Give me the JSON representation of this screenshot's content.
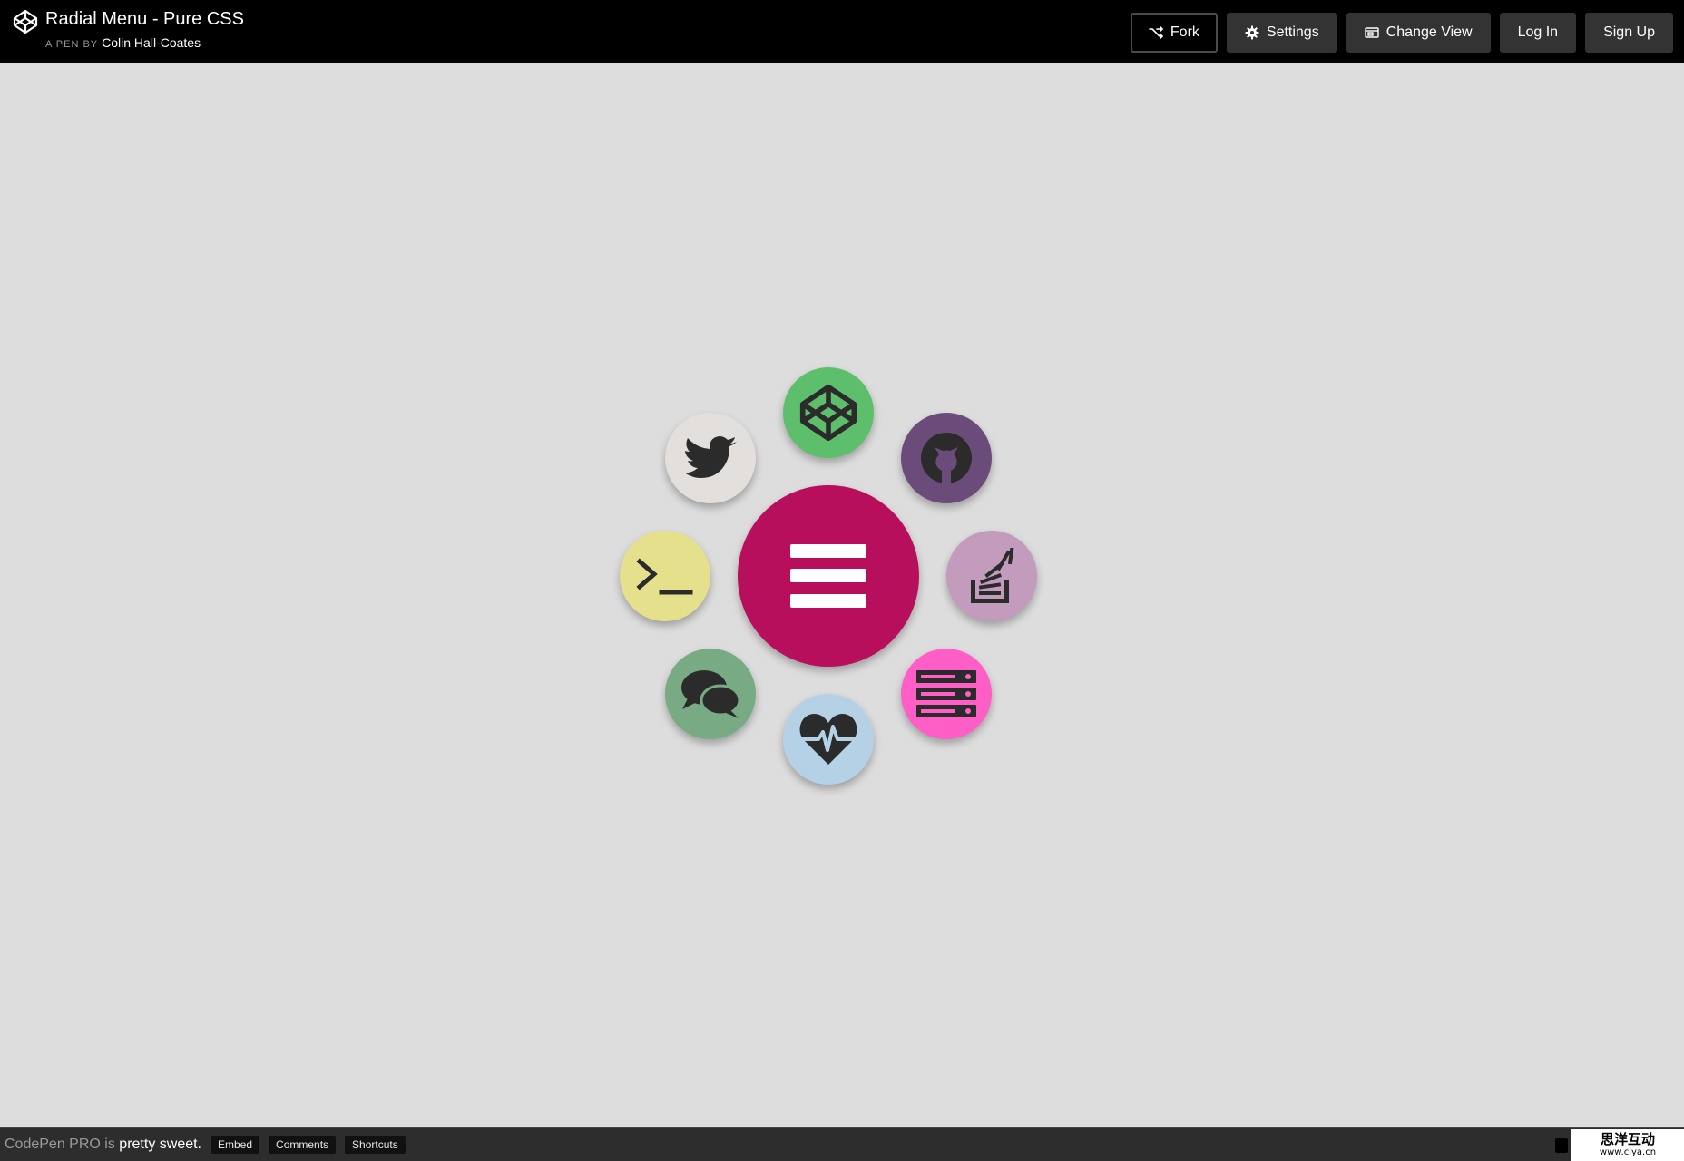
{
  "header": {
    "title": "Radial Menu - Pure CSS",
    "byline_prefix": "A PEN BY",
    "author": "Colin Hall-Coates",
    "buttons": {
      "fork": "Fork",
      "settings": "Settings",
      "change_view": "Change View",
      "log_in": "Log In",
      "sign_up": "Sign Up"
    }
  },
  "menu": {
    "center": {
      "icon": "hamburger-icon",
      "color": "#b80f5c"
    },
    "items": [
      {
        "icon": "codepen-icon",
        "color": "#5dbf6b"
      },
      {
        "icon": "github-icon",
        "color": "#6b4b7a"
      },
      {
        "icon": "stackoverflow-icon",
        "color": "#c29bbd"
      },
      {
        "icon": "server-icon",
        "color": "#ff5ec7"
      },
      {
        "icon": "heartbeat-icon",
        "color": "#b5d1e6"
      },
      {
        "icon": "comments-icon",
        "color": "#78ab83"
      },
      {
        "icon": "terminal-icon",
        "color": "#e5e08c"
      },
      {
        "icon": "twitter-icon",
        "color": "#e2dfdc"
      }
    ]
  },
  "footer": {
    "promo_muted": "CodePen PRO",
    "promo_is": " is ",
    "promo_text": "pretty sweet.",
    "buttons": {
      "embed": "Embed",
      "comments": "Comments",
      "shortcuts": "Shortcuts"
    },
    "watermark_cn": "思洋互动",
    "watermark_url": "www.ciya.cn"
  },
  "colors": {
    "header_bg": "#000000",
    "page_bg": "#dddddd",
    "button_bg": "#333333",
    "footer_bg": "#2d2d2d"
  }
}
